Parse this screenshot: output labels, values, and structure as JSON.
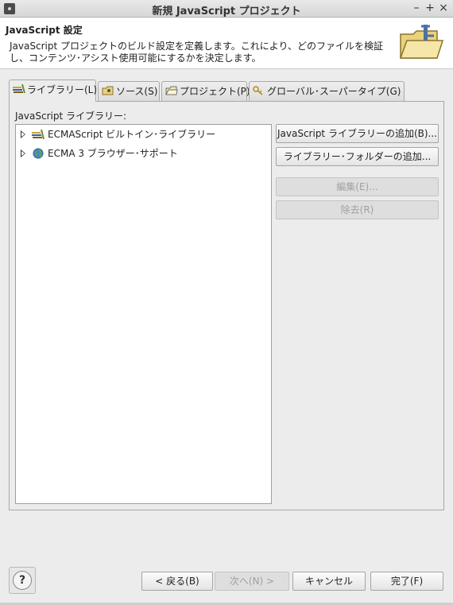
{
  "window": {
    "title": "新規 JavaScript プロジェクト",
    "minimize": "–",
    "maximize": "+",
    "close": "×"
  },
  "banner": {
    "title": "JavaScript 設定",
    "description": "JavaScript プロジェクトのビルド設定を定義します。これにより、どのファイルを検証し、コンテンツ･アシスト使用可能にするかを決定します。"
  },
  "tabs": [
    {
      "label": "ライブラリー(L)",
      "icon": "library-icon",
      "active": true
    },
    {
      "label": "ソース(S)",
      "icon": "source-icon",
      "active": false
    },
    {
      "label": "プロジェクト(P)",
      "icon": "project-folder-icon",
      "active": false
    },
    {
      "label": "グローバル･スーパータイプ(G)",
      "icon": "supertype-icon",
      "active": false
    }
  ],
  "panel": {
    "label": "JavaScript ライブラリー:",
    "tree": [
      {
        "label": "ECMAScript ビルトイン･ライブラリー",
        "icon": "library-icon"
      },
      {
        "label": "ECMA 3 ブラウザー･サポート",
        "icon": "globe-icon"
      }
    ],
    "buttons": {
      "add_library": "JavaScript ライブラリーの追加(B)...",
      "add_folder": "ライブラリー･フォルダーの追加...",
      "edit": "編集(E)...",
      "remove": "除去(R)"
    }
  },
  "footer": {
    "help": "?",
    "back": "< 戻る(B)",
    "next": "次へ(N) >",
    "cancel": "キャンセル",
    "finish": "完了(F)"
  }
}
